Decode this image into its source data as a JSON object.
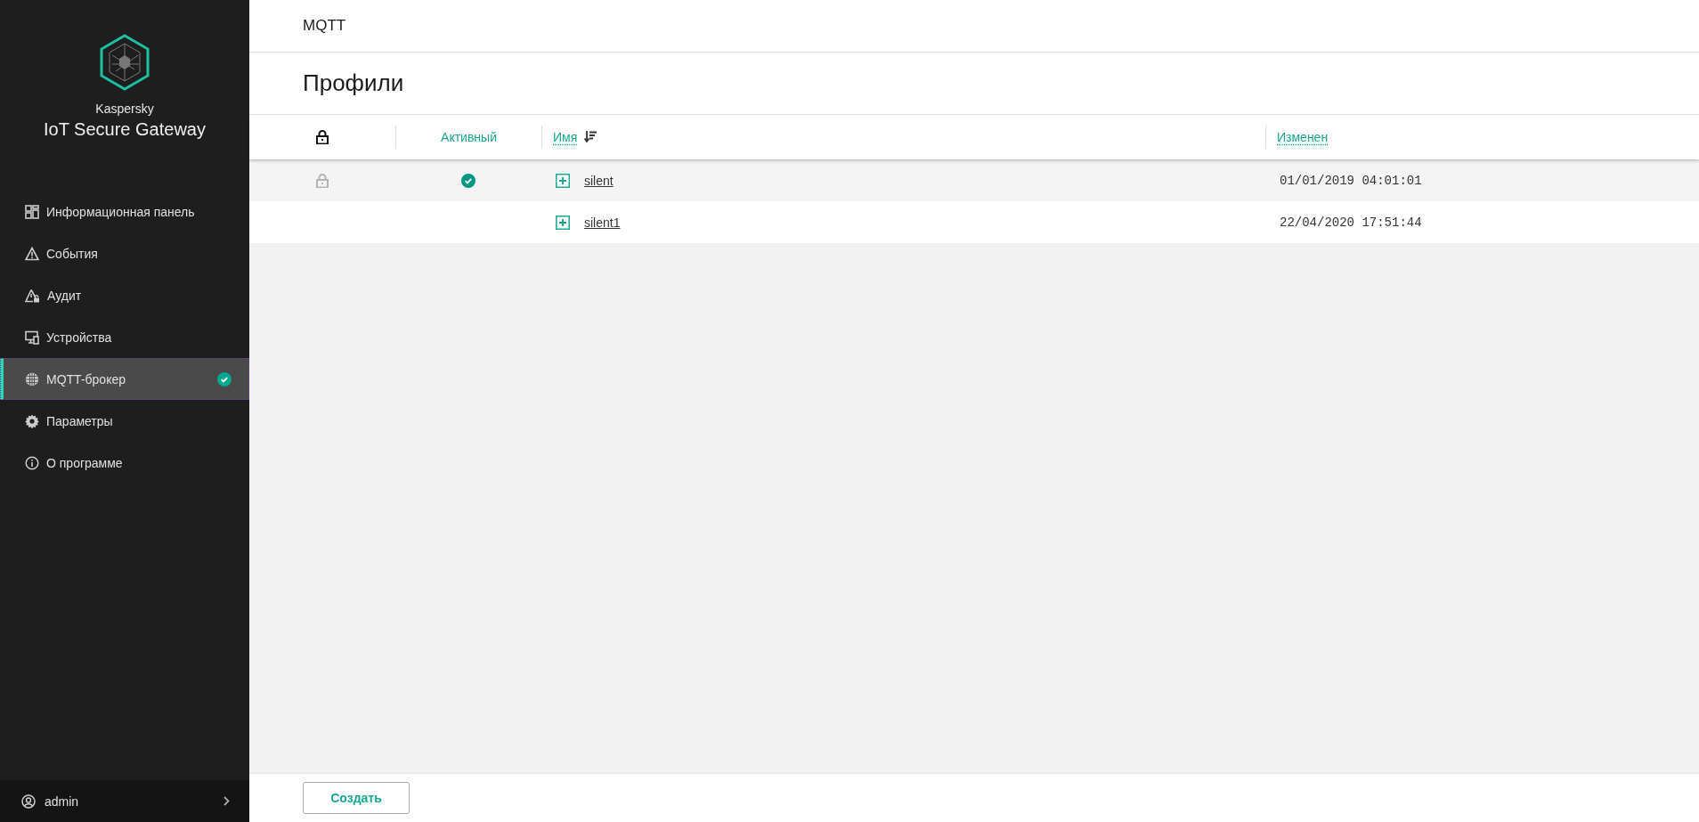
{
  "sidebar": {
    "brand": "Kaspersky",
    "product": "IoT Secure Gateway",
    "items": [
      {
        "label": "Информационная панель",
        "kind": "dashboard",
        "selected": false,
        "ok": false
      },
      {
        "label": "События",
        "kind": "warning",
        "selected": false,
        "ok": false
      },
      {
        "label": "Аудит",
        "kind": "audit",
        "selected": false,
        "ok": false
      },
      {
        "label": "Устройства",
        "kind": "devices",
        "selected": false,
        "ok": false
      },
      {
        "label": "MQTT-брокер",
        "kind": "globe",
        "selected": true,
        "ok": true
      },
      {
        "label": "Параметры",
        "kind": "gear",
        "selected": false,
        "ok": false
      },
      {
        "label": "О программе",
        "kind": "info",
        "selected": false,
        "ok": false
      }
    ],
    "user": "admin"
  },
  "breadcrumb": "MQTT",
  "page_title": "Профили",
  "table": {
    "columns": [
      {
        "kind": "lock"
      },
      {
        "kind": "text",
        "label": "Активный"
      },
      {
        "kind": "link",
        "label": "Имя",
        "sorted": true
      },
      {
        "kind": "link",
        "label": "Изменен",
        "sorted": false
      }
    ],
    "rows": [
      {
        "locked": true,
        "active": true,
        "expanded": false,
        "name": "silent",
        "modified": "01/01/2019 04:01:01"
      },
      {
        "locked": false,
        "active": false,
        "expanded": false,
        "name": "silent1",
        "modified": "22/04/2020 17:51:44"
      }
    ]
  },
  "buttons": [
    {
      "label": "Создать"
    }
  ]
}
